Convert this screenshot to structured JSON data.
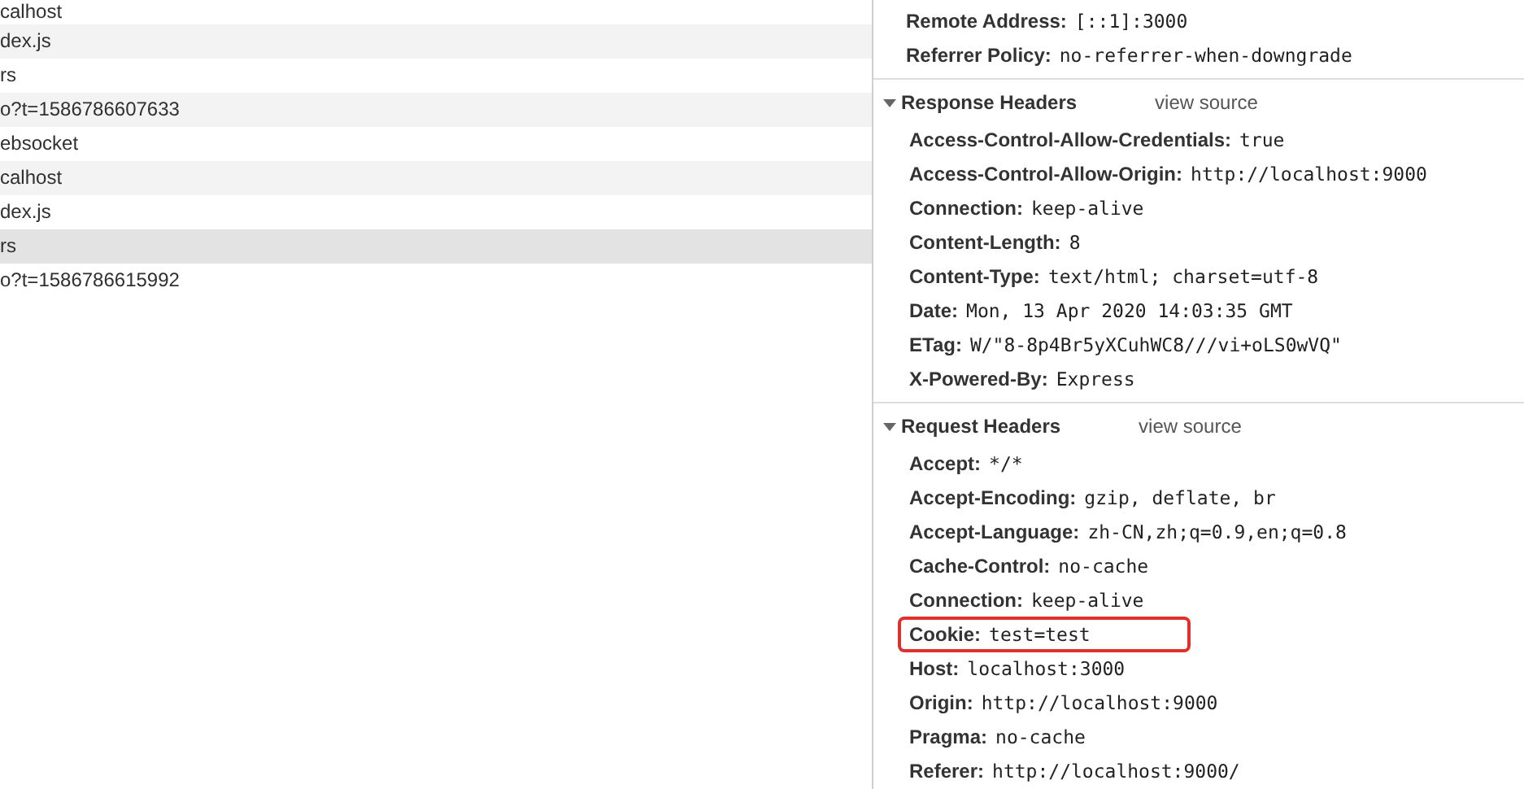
{
  "requests": [
    {
      "name": "calhost",
      "selected": false
    },
    {
      "name": "dex.js",
      "selected": false
    },
    {
      "name": "rs",
      "selected": false
    },
    {
      "name": "o?t=1586786607633",
      "selected": false
    },
    {
      "name": "ebsocket",
      "selected": false
    },
    {
      "name": "calhost",
      "selected": false
    },
    {
      "name": "dex.js",
      "selected": false
    },
    {
      "name": "rs",
      "selected": true
    },
    {
      "name": "o?t=1586786615992",
      "selected": false
    }
  ],
  "general": [
    {
      "key": "Remote Address:",
      "value": "[::1]:3000"
    },
    {
      "key": "Referrer Policy:",
      "value": "no-referrer-when-downgrade"
    }
  ],
  "sections": [
    {
      "title": "Response Headers",
      "expanded": true,
      "link": "view source",
      "headers": [
        {
          "key": "Access-Control-Allow-Credentials:",
          "value": "true",
          "highlighted": false
        },
        {
          "key": "Access-Control-Allow-Origin:",
          "value": "http://localhost:9000",
          "highlighted": false
        },
        {
          "key": "Connection:",
          "value": "keep-alive",
          "highlighted": false
        },
        {
          "key": "Content-Length:",
          "value": "8",
          "highlighted": false
        },
        {
          "key": "Content-Type:",
          "value": "text/html; charset=utf-8",
          "highlighted": false
        },
        {
          "key": "Date:",
          "value": "Mon, 13 Apr 2020 14:03:35 GMT",
          "highlighted": false
        },
        {
          "key": "ETag:",
          "value": "W/\"8-8p4Br5yXCuhWC8///vi+oLS0wVQ\"",
          "highlighted": false
        },
        {
          "key": "X-Powered-By:",
          "value": "Express",
          "highlighted": false
        }
      ]
    },
    {
      "title": "Request Headers",
      "expanded": true,
      "link": "view source",
      "headers": [
        {
          "key": "Accept:",
          "value": "*/*",
          "highlighted": false
        },
        {
          "key": "Accept-Encoding:",
          "value": "gzip, deflate, br",
          "highlighted": false
        },
        {
          "key": "Accept-Language:",
          "value": "zh-CN,zh;q=0.9,en;q=0.8",
          "highlighted": false
        },
        {
          "key": "Cache-Control:",
          "value": "no-cache",
          "highlighted": false
        },
        {
          "key": "Connection:",
          "value": "keep-alive",
          "highlighted": false
        },
        {
          "key": "Cookie:",
          "value": "test=test",
          "highlighted": true
        },
        {
          "key": "Host:",
          "value": "localhost:3000",
          "highlighted": false
        },
        {
          "key": "Origin:",
          "value": "http://localhost:9000",
          "highlighted": false
        },
        {
          "key": "Pragma:",
          "value": "no-cache",
          "highlighted": false
        },
        {
          "key": "Referer:",
          "value": "http://localhost:9000/",
          "highlighted": false
        }
      ]
    }
  ]
}
